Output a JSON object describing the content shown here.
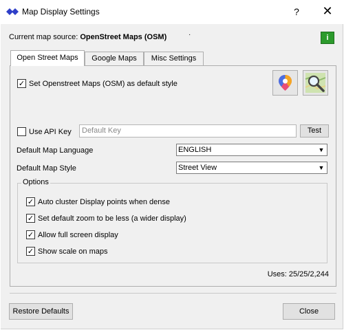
{
  "window": {
    "title": "Map Display Settings",
    "help_label": "?",
    "close_label": "✕"
  },
  "source": {
    "prefix": "Current map source:",
    "name": "OpenStreet Maps (OSM)",
    "info_label": "i"
  },
  "tabs": [
    {
      "label": "Open Street Maps",
      "active": true
    },
    {
      "label": "Google Maps",
      "active": false
    },
    {
      "label": "Misc Settings",
      "active": false
    }
  ],
  "osm": {
    "default_style_label": "Set Openstreet Maps (OSM) as default style",
    "default_style_checked": true,
    "api_key_label": "Use API Key",
    "api_key_checked": false,
    "api_key_placeholder": "Default Key",
    "test_label": "Test",
    "language_label": "Default Map Language",
    "language_value": "ENGLISH",
    "style_label": "Default Map Style",
    "style_value": "Street View",
    "icons": [
      "map-pin-icon",
      "map-search-icon"
    ]
  },
  "options": {
    "title": "Options",
    "items": [
      {
        "label": "Auto cluster Display points when dense",
        "checked": true
      },
      {
        "label": "Set default zoom to be less (a wider display)",
        "checked": true
      },
      {
        "label": "Allow full screen display",
        "checked": true
      },
      {
        "label": "Show scale on maps",
        "checked": true
      }
    ]
  },
  "uses": "Uses: 25/25/2,244",
  "footer": {
    "restore_label": "Restore Defaults",
    "close_label": "Close"
  },
  "colors": {
    "accent": "#2c9a2c",
    "app_icon": "#2f3fc8"
  }
}
